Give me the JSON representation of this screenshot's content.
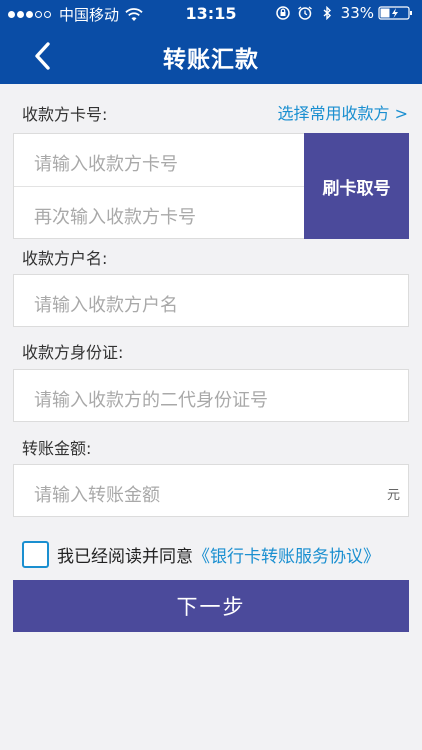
{
  "status_bar": {
    "carrier": "中国移动",
    "time": "13:15",
    "battery": "33%"
  },
  "nav": {
    "title": "转账汇款",
    "back_icon": "chevron-left-icon"
  },
  "form": {
    "card_label": "收款方卡号:",
    "choose_payee_link": "选择常用收款方 >",
    "card_input": {
      "placeholder": "请输入收款方卡号",
      "value": ""
    },
    "card_confirm_input": {
      "placeholder": "再次输入收款方卡号",
      "value": ""
    },
    "swipe_button": "刷卡取号",
    "name_label": "收款方户名:",
    "name_input": {
      "placeholder": "请输入收款方户名",
      "value": ""
    },
    "id_label": "收款方身份证:",
    "id_input": {
      "placeholder": "请输入收款方的二代身份证号",
      "value": ""
    },
    "amount_label": "转账金额:",
    "amount_input": {
      "placeholder": "请输入转账金额",
      "value": ""
    },
    "amount_unit": "元"
  },
  "agreement": {
    "text": "我已经阅读并同意",
    "link": "《银行卡转账服务协议》",
    "checked": false
  },
  "next_button": "下一步",
  "colors": {
    "header_blue": "#0a4da6",
    "button_purple": "#4b4a9b",
    "link_blue": "#1a8fd0",
    "background": "#f2f2f4"
  }
}
